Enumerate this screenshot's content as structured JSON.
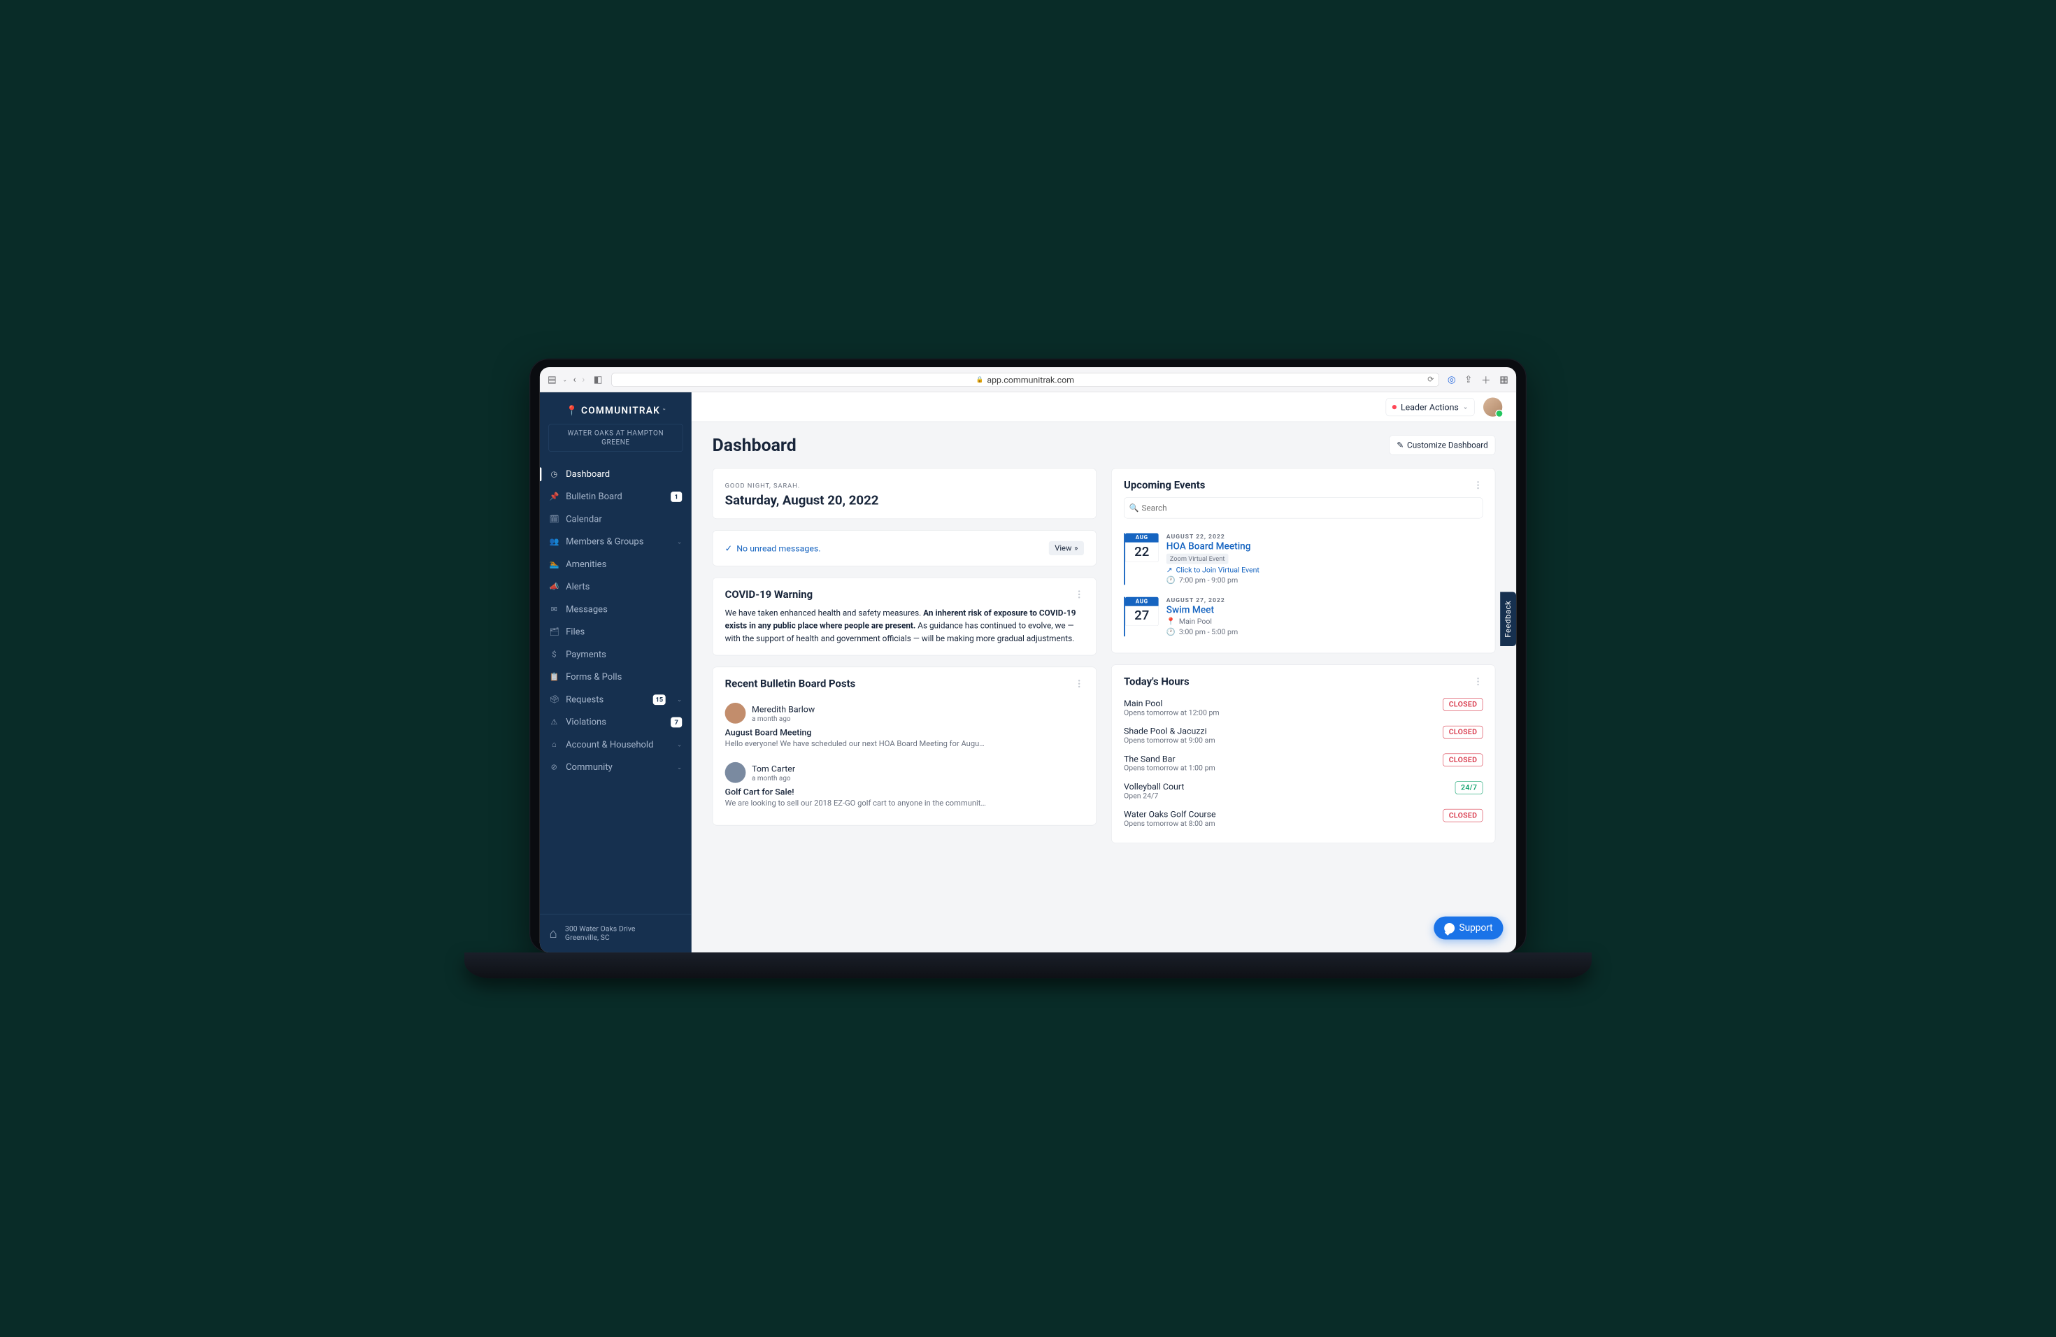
{
  "browser": {
    "url": "app.communitrak.com"
  },
  "brand": {
    "name": "COMMUNITRAK",
    "tm": "™"
  },
  "community_button": "WATER OAKS AT HAMPTON GREENE",
  "nav": [
    {
      "icon": "◷",
      "label": "Dashboard",
      "active": true
    },
    {
      "icon": "📌",
      "label": "Bulletin Board",
      "badge": "1"
    },
    {
      "icon": "🗓",
      "label": "Calendar"
    },
    {
      "icon": "👥",
      "label": "Members & Groups",
      "chevron": true
    },
    {
      "icon": "🏊",
      "label": "Amenities"
    },
    {
      "icon": "📣",
      "label": "Alerts"
    },
    {
      "icon": "✉",
      "label": "Messages"
    },
    {
      "icon": "🗂",
      "label": "Files"
    },
    {
      "icon": "$",
      "label": "Payments"
    },
    {
      "icon": "📋",
      "label": "Forms & Polls"
    },
    {
      "icon": "🗳",
      "label": "Requests",
      "badge": "15",
      "chevron": true
    },
    {
      "icon": "⚠",
      "label": "Violations",
      "badge": "7"
    },
    {
      "icon": "⌂",
      "label": "Account & Household",
      "chevron": true
    },
    {
      "icon": "⊘",
      "label": "Community",
      "chevron": true
    }
  ],
  "sidebar_footer": {
    "line1": "300 Water Oaks Drive",
    "line2": "Greenville, SC"
  },
  "topbar": {
    "leader_actions": "Leader Actions"
  },
  "page": {
    "title": "Dashboard",
    "customize": "Customize Dashboard"
  },
  "greeting": {
    "hello": "GOOD NIGHT, SARAH.",
    "date": "Saturday, August 20, 2022"
  },
  "messages_card": {
    "text": "No unread messages.",
    "view": "View"
  },
  "covid": {
    "title": "COVID-19 Warning",
    "p1": "We have taken enhanced health and safety measures. ",
    "bold": "An inherent risk of exposure to COVID-19 exists in any public place where people are present.",
    "p2": " As guidance has continued to evolve, we — with the support of health and government officials — will be making more gradual adjustments."
  },
  "bulletin": {
    "title": "Recent Bulletin Board Posts",
    "posts": [
      {
        "author": "Meredith Barlow",
        "ago": "a month ago",
        "title": "August Board Meeting",
        "snippet": "Hello everyone! We have scheduled our next HOA Board Meeting for Augu…"
      },
      {
        "author": "Tom Carter",
        "ago": "a month ago",
        "title": "Golf Cart for Sale!",
        "snippet": "We are looking to sell our 2018 EZ-GO golf cart to anyone in the communit…"
      }
    ]
  },
  "events": {
    "title": "Upcoming Events",
    "search_placeholder": "Search",
    "items": [
      {
        "month_abbr": "AUG",
        "day": "22",
        "date_full": "AUGUST 22, 2022",
        "title": "HOA Board Meeting",
        "tag": "Zoom Virtual Event",
        "link_text": "Click to Join Virtual Event",
        "time": "7:00 pm - 9:00 pm"
      },
      {
        "month_abbr": "AUG",
        "day": "27",
        "date_full": "AUGUST 27, 2022",
        "title": "Swim Meet",
        "location": "Main Pool",
        "time": "3:00 pm - 5:00 pm"
      }
    ]
  },
  "hours": {
    "title": "Today's Hours",
    "items": [
      {
        "name": "Main Pool",
        "sub": "Opens tomorrow at 12:00 pm",
        "status": "CLOSED"
      },
      {
        "name": "Shade Pool & Jacuzzi",
        "sub": "Opens tomorrow at 9:00 am",
        "status": "CLOSED"
      },
      {
        "name": "The Sand Bar",
        "sub": "Opens tomorrow at 1:00 pm",
        "status": "CLOSED"
      },
      {
        "name": "Volleyball Court",
        "sub": "Open 24/7",
        "status": "24/7",
        "open": true
      },
      {
        "name": "Water Oaks Golf Course",
        "sub": "Opens tomorrow at 8:00 am",
        "status": "CLOSED"
      }
    ]
  },
  "feedback_tab": "Feedback",
  "support_fab": "Support"
}
